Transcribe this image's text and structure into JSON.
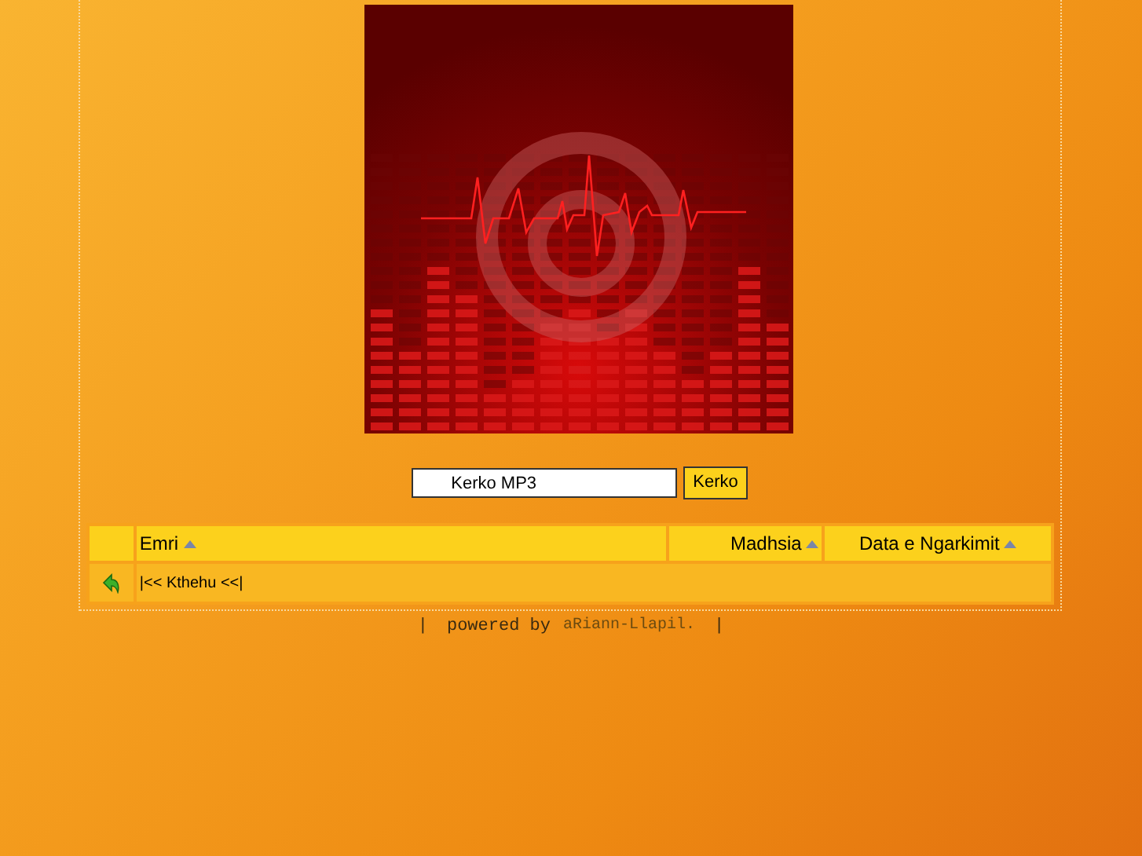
{
  "search": {
    "value": "Kerko MP3",
    "button": "Kerko"
  },
  "table": {
    "columns": [
      {
        "label": "Emri"
      },
      {
        "label": "Madhsia"
      },
      {
        "label": "Data e Ngarkimit"
      }
    ],
    "rows": [
      {
        "kind": "back",
        "label": "|<< Kthehu <<|"
      }
    ]
  },
  "footer": {
    "separator_left": "|",
    "text": "powered by",
    "brand": "aRiann-Llapil.",
    "separator_right": "|"
  }
}
